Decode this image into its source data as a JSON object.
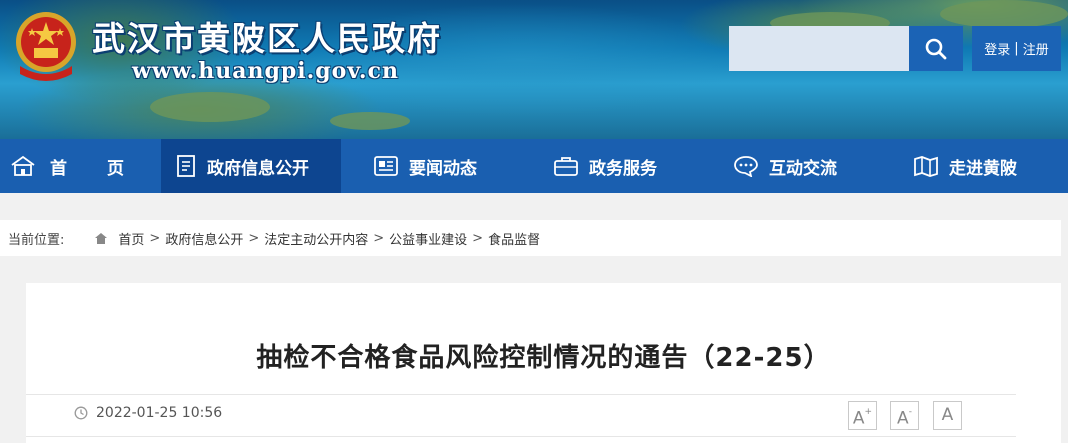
{
  "header": {
    "site_title": "武汉市黄陂区人民政府",
    "site_url": "www.huangpi.gov.cn",
    "search_placeholder": "",
    "login_label": "登录",
    "separator": "|",
    "register_label": "注册"
  },
  "nav": {
    "items": [
      {
        "label_a": "首",
        "label_b": "页",
        "icon": "home-icon"
      },
      {
        "label": "政府信息公开",
        "icon": "document-icon",
        "active": true
      },
      {
        "label": "要闻动态",
        "icon": "news-icon"
      },
      {
        "label": "政务服务",
        "icon": "briefcase-icon"
      },
      {
        "label": "互动交流",
        "icon": "chat-icon"
      },
      {
        "label": "走进黄陂",
        "icon": "map-icon"
      }
    ]
  },
  "breadcrumb": {
    "prefix": "当前位置:",
    "items": [
      "首页",
      "政府信息公开",
      "法定主动公开内容",
      "公益事业建设",
      "食品监督"
    ],
    "separator": ">"
  },
  "article": {
    "title": "抽检不合格食品风险控制情况的通告（22-25）",
    "publish_time": "2022-01-25 10:56",
    "font_sizes": [
      {
        "label": "A",
        "sup": "+"
      },
      {
        "label": "A",
        "sup": "-"
      },
      {
        "label": "A",
        "sup": ""
      }
    ]
  },
  "colors": {
    "nav_bg": "#1a5fb0",
    "nav_active_bg": "#0d4590",
    "search_button": "#1b63b5",
    "page_bg": "#f1f1f1"
  }
}
